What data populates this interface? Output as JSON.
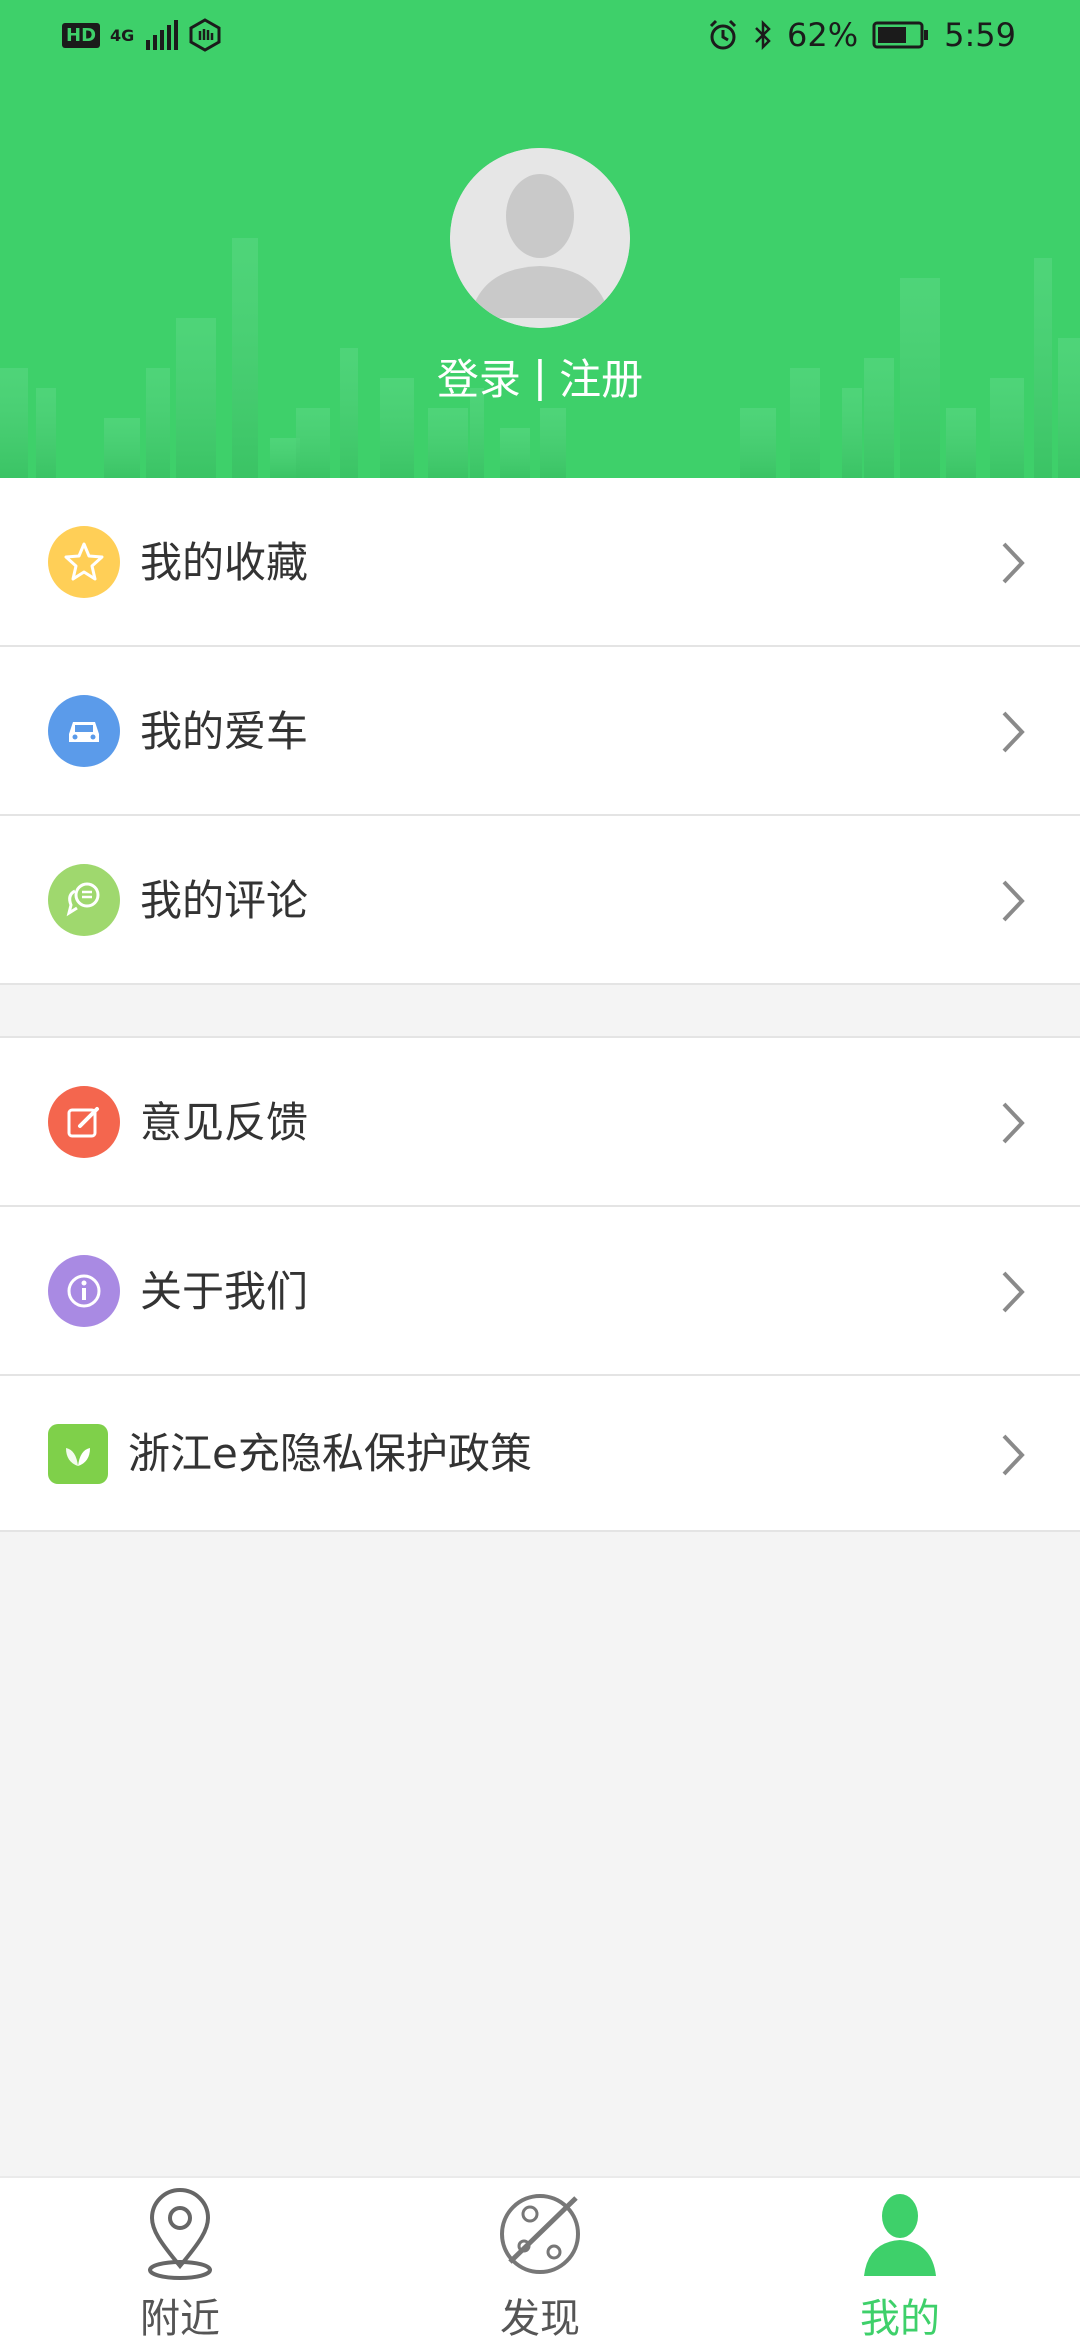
{
  "status_bar": {
    "network_left": "HD",
    "signal_label": "4G",
    "battery_percent": "62%",
    "time": "5:59"
  },
  "header": {
    "login_label": "登录",
    "separator": "|",
    "register_label": "注册",
    "background_color": "#3ed06a"
  },
  "menu_group_1": [
    {
      "label": "我的收藏",
      "icon": "star-icon",
      "color": "#ffcf57"
    },
    {
      "label": "我的爱车",
      "icon": "car-icon",
      "color": "#5b9bea"
    },
    {
      "label": "我的评论",
      "icon": "comment-icon",
      "color": "#9fd86e"
    }
  ],
  "menu_group_2": [
    {
      "label": "意见反馈",
      "icon": "edit-icon",
      "color": "#f4664e"
    },
    {
      "label": "关于我们",
      "icon": "info-icon",
      "color": "#a98ae3"
    },
    {
      "label": "浙江e充隐私保护政策",
      "icon": "leaf-icon",
      "color": "#7fd04a"
    }
  ],
  "bottom_nav": {
    "tabs": [
      {
        "label": "附近",
        "icon": "location-pin-icon",
        "active": false
      },
      {
        "label": "发现",
        "icon": "planet-icon",
        "active": false
      },
      {
        "label": "我的",
        "icon": "user-icon",
        "active": true
      }
    ],
    "active_color": "#3ed06a"
  }
}
